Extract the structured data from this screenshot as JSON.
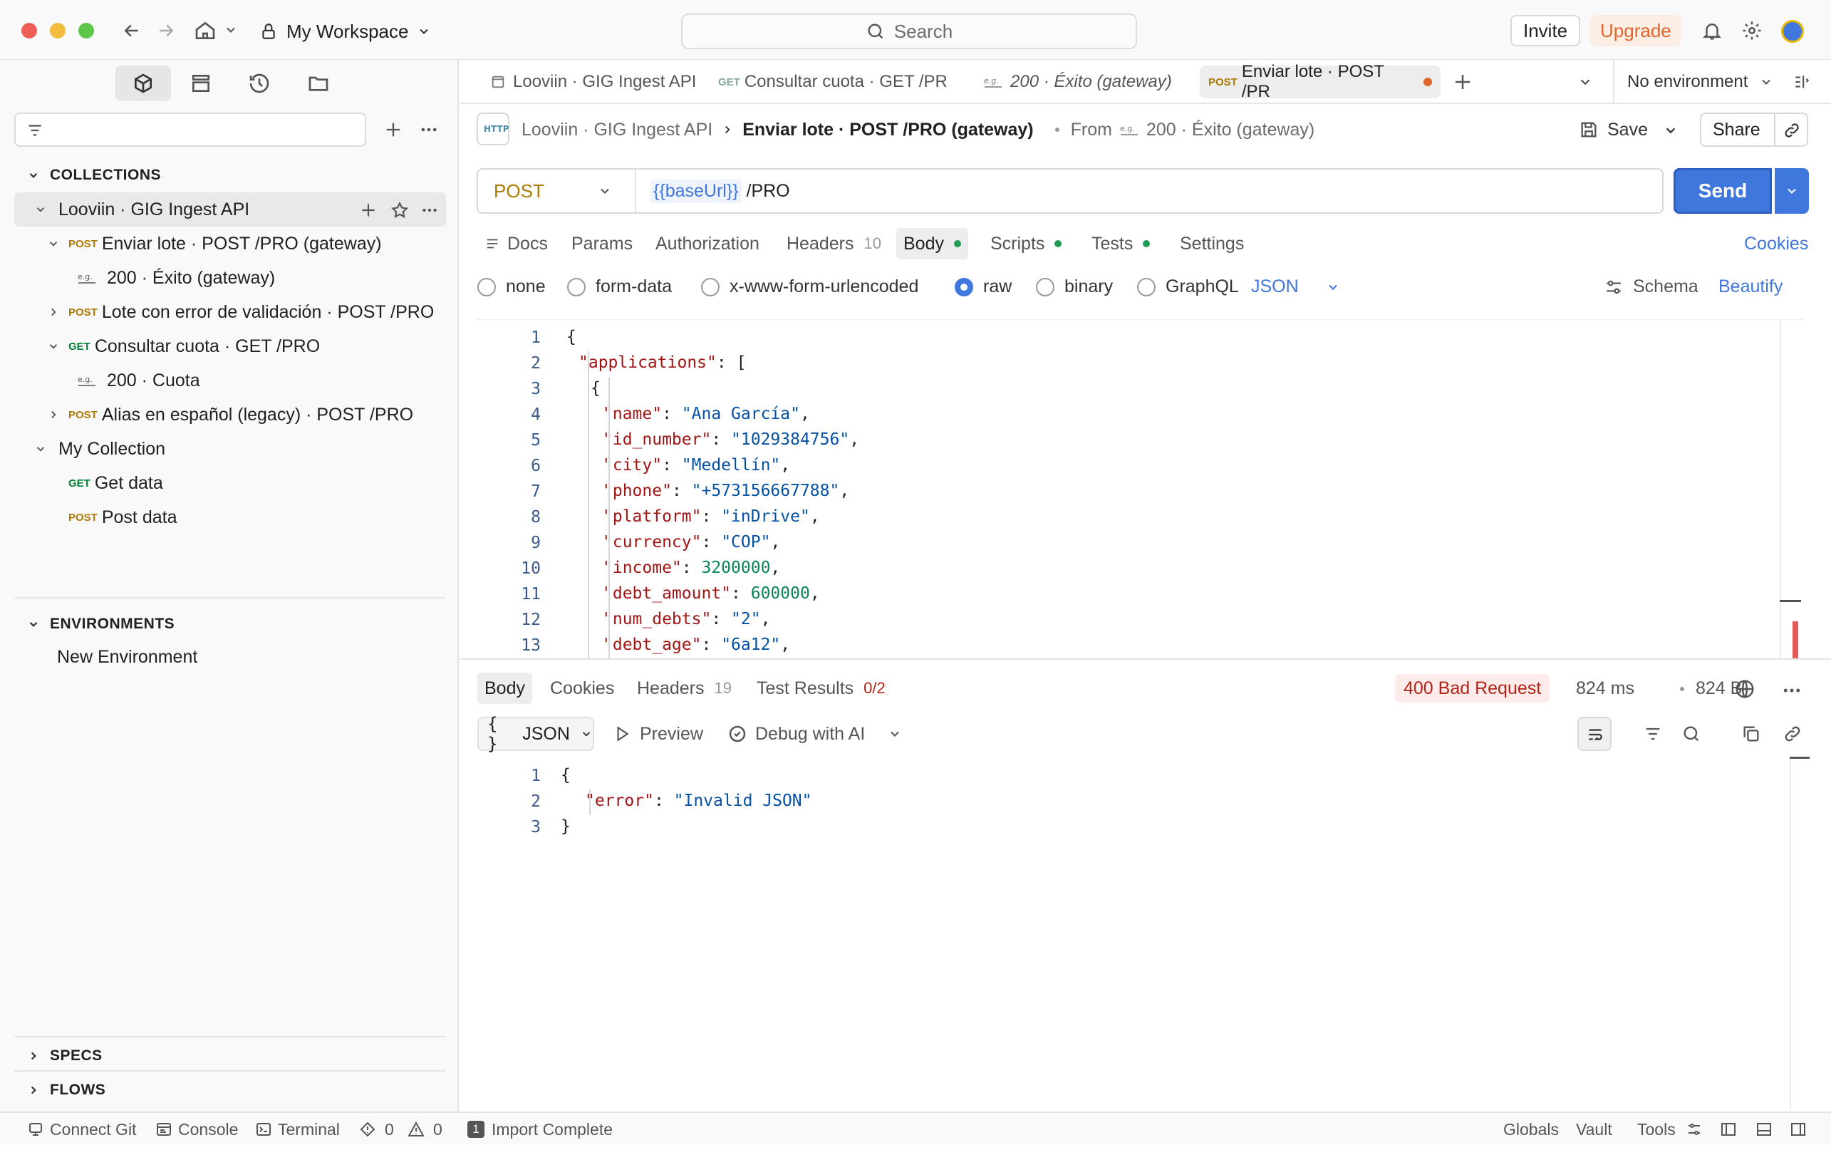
{
  "titlebar": {
    "workspace": "My Workspace",
    "search_placeholder": "Search",
    "invite": "Invite",
    "upgrade": "Upgrade"
  },
  "sidebar": {
    "collections_header": "COLLECTIONS",
    "collections": [
      {
        "name": "Looviin · GIG Ingest API",
        "items": [
          {
            "method": "POST",
            "label": "Enviar lote · POST /PRO (gateway)"
          },
          {
            "example": "200 · Éxito (gateway)"
          },
          {
            "method": "POST",
            "label": "Lote con error de validación · POST /PRO"
          },
          {
            "method": "GET",
            "label": "Consultar cuota · GET /PRO"
          },
          {
            "example": "200 · Cuota"
          },
          {
            "method": "POST",
            "label": "Alias en español (legacy) · POST /PRO"
          }
        ]
      },
      {
        "name": "My Collection",
        "items": [
          {
            "method": "GET",
            "label": "Get data"
          },
          {
            "method": "POST",
            "label": "Post data"
          }
        ]
      }
    ],
    "environments_header": "ENVIRONMENTS",
    "environment_item": "New Environment",
    "specs_header": "SPECS",
    "flows_header": "FLOWS"
  },
  "tabs": [
    {
      "label": "Looviin · GIG Ingest API"
    },
    {
      "method": "GET",
      "label": "Consultar cuota · GET /PR"
    },
    {
      "label": "200 · Éxito (gateway)"
    },
    {
      "method": "POST",
      "label": "Enviar lote · POST /PR"
    }
  ],
  "environment_select": "No environment",
  "breadcrumb": {
    "collection": "Looviin · GIG Ingest API",
    "request": "Enviar lote · POST /PRO (gateway)",
    "from_label": "From",
    "from_example": "200 · Éxito (gateway)"
  },
  "actions": {
    "save": "Save",
    "share": "Share"
  },
  "request": {
    "method": "POST",
    "url_var": "{{baseUrl}}",
    "url_path": " /PRO",
    "send": "Send"
  },
  "request_tabs": {
    "docs": "Docs",
    "params": "Params",
    "authorization": "Authorization",
    "headers": "Headers",
    "headers_count": "10",
    "body": "Body",
    "scripts": "Scripts",
    "tests": "Tests",
    "settings": "Settings",
    "cookies": "Cookies"
  },
  "body_types": {
    "none": "none",
    "form_data": "form-data",
    "urlencoded": "x-www-form-urlencoded",
    "raw": "raw",
    "binary": "binary",
    "graphql": "GraphQL",
    "format": "JSON",
    "schema": "Schema",
    "beautify": "Beautify"
  },
  "request_body_lines": [
    {
      "n": "1",
      "indent": 0,
      "parts": [
        [
          "p",
          "{"
        ]
      ]
    },
    {
      "n": "2",
      "indent": 1,
      "parts": [
        [
          "k",
          "\"applications\""
        ],
        [
          "p",
          ": ["
        ]
      ]
    },
    {
      "n": "3",
      "indent": 2,
      "parts": [
        [
          "p",
          "{"
        ]
      ]
    },
    {
      "n": "4",
      "indent": 3,
      "parts": [
        [
          "k",
          "\"name\""
        ],
        [
          "p",
          ": "
        ],
        [
          "s",
          "\"Ana García\""
        ],
        [
          "p",
          ","
        ]
      ]
    },
    {
      "n": "5",
      "indent": 3,
      "parts": [
        [
          "k",
          "\"id_number\""
        ],
        [
          "p",
          ": "
        ],
        [
          "s",
          "\"1029384756\""
        ],
        [
          "p",
          ","
        ]
      ]
    },
    {
      "n": "6",
      "indent": 3,
      "parts": [
        [
          "k",
          "\"city\""
        ],
        [
          "p",
          ": "
        ],
        [
          "s",
          "\"Medellín\""
        ],
        [
          "p",
          ","
        ]
      ]
    },
    {
      "n": "7",
      "indent": 3,
      "parts": [
        [
          "k",
          "\"phone\""
        ],
        [
          "p",
          ": "
        ],
        [
          "s",
          "\"+573156667788\""
        ],
        [
          "p",
          ","
        ]
      ]
    },
    {
      "n": "8",
      "indent": 3,
      "parts": [
        [
          "k",
          "\"platform\""
        ],
        [
          "p",
          ": "
        ],
        [
          "s",
          "\"inDrive\""
        ],
        [
          "p",
          ","
        ]
      ]
    },
    {
      "n": "9",
      "indent": 3,
      "parts": [
        [
          "k",
          "\"currency\""
        ],
        [
          "p",
          ": "
        ],
        [
          "s",
          "\"COP\""
        ],
        [
          "p",
          ","
        ]
      ]
    },
    {
      "n": "10",
      "indent": 3,
      "parts": [
        [
          "k",
          "\"income\""
        ],
        [
          "p",
          ": "
        ],
        [
          "n",
          "3200000"
        ],
        [
          "p",
          ","
        ]
      ]
    },
    {
      "n": "11",
      "indent": 3,
      "parts": [
        [
          "k",
          "\"debt_amount\""
        ],
        [
          "p",
          ": "
        ],
        [
          "n",
          "600000"
        ],
        [
          "p",
          ","
        ]
      ]
    },
    {
      "n": "12",
      "indent": 3,
      "parts": [
        [
          "k",
          "\"num_debts\""
        ],
        [
          "p",
          ": "
        ],
        [
          "s",
          "\"2\""
        ],
        [
          "p",
          ","
        ]
      ]
    },
    {
      "n": "13",
      "indent": 3,
      "parts": [
        [
          "k",
          "\"debt_age\""
        ],
        [
          "p",
          ": "
        ],
        [
          "s",
          "\"6a12\""
        ],
        [
          "p",
          ","
        ]
      ]
    }
  ],
  "response_tabs": {
    "body": "Body",
    "cookies": "Cookies",
    "headers": "Headers",
    "headers_count": "19",
    "test_results": "Test Results",
    "test_count": "0/2"
  },
  "response_meta": {
    "status": "400 Bad Request",
    "time": "824 ms",
    "size": "824 B"
  },
  "response_toolbar": {
    "format": "JSON",
    "preview": "Preview",
    "debug": "Debug with AI"
  },
  "response_body_lines": [
    {
      "n": "1",
      "indent": 0,
      "parts": [
        [
          "p",
          "{"
        ]
      ]
    },
    {
      "n": "2",
      "indent": 1,
      "parts": [
        [
          "k",
          "\"error\""
        ],
        [
          "p",
          ": "
        ],
        [
          "s",
          "\"Invalid JSON\""
        ]
      ]
    },
    {
      "n": "3",
      "indent": 0,
      "parts": [
        [
          "p",
          "}"
        ]
      ]
    }
  ],
  "statusbar": {
    "connect_git": "Connect Git",
    "console": "Console",
    "terminal": "Terminal",
    "errors": "0",
    "warnings": "0",
    "import_badge": "1",
    "import": "Import Complete",
    "globals": "Globals",
    "vault": "Vault",
    "tools": "Tools"
  },
  "colors": {
    "accent": "#3f77dd",
    "upgrade": "#e0662c",
    "post": "#ad7a03",
    "get": "#007f31",
    "error_status": "#b42318"
  }
}
